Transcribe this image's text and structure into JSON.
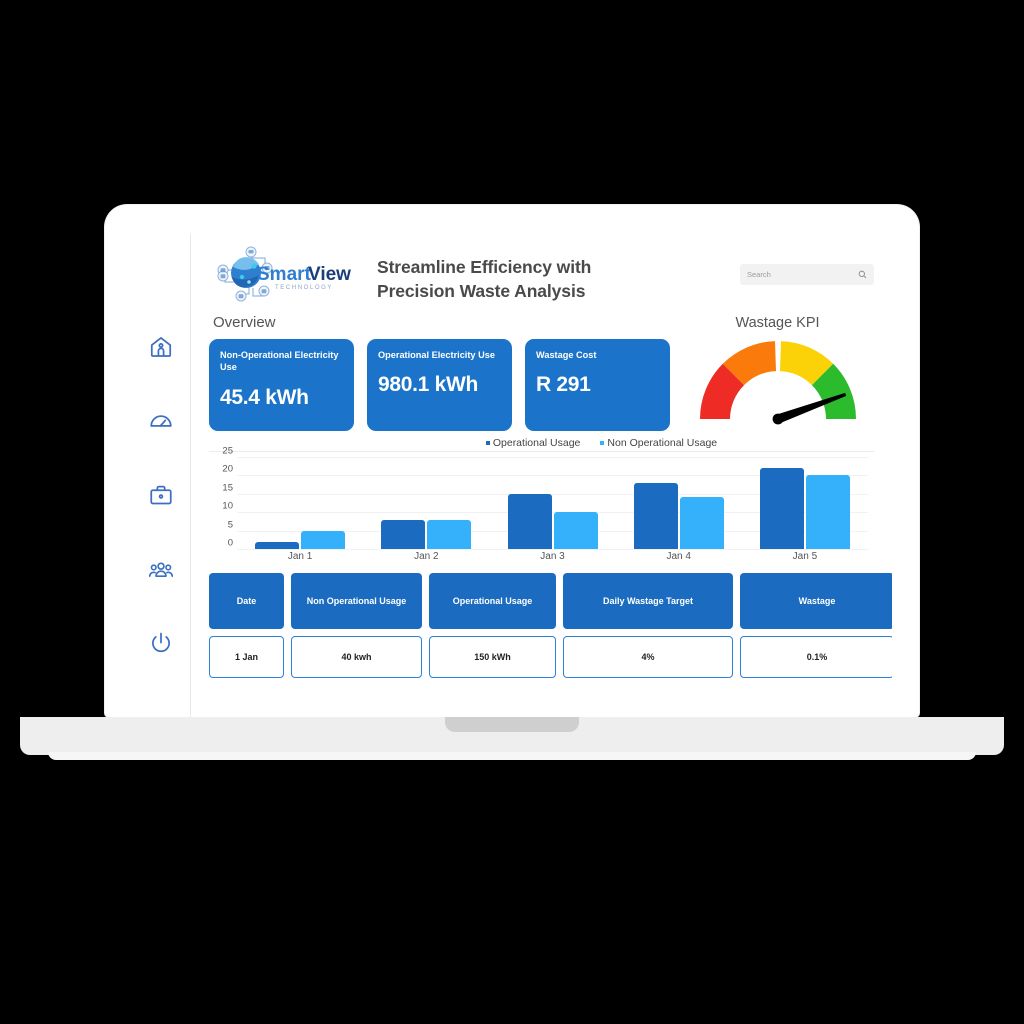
{
  "brand": {
    "name_light": "Smart",
    "name_bold": "View",
    "tagline": "TECHNOLOGY"
  },
  "header": {
    "title_line1": "Streamline Efficiency with",
    "title_line2": "Precision Waste Analysis",
    "search_placeholder": "Search",
    "search_value": "",
    "search_icon": "search-icon"
  },
  "sidebar": {
    "items": [
      {
        "name": "home",
        "icon": "home-icon"
      },
      {
        "name": "dashboard",
        "icon": "gauge-icon"
      },
      {
        "name": "briefcase",
        "icon": "briefcase-icon"
      },
      {
        "name": "users",
        "icon": "users-icon"
      },
      {
        "name": "power",
        "icon": "power-icon"
      }
    ]
  },
  "overview": {
    "label": "Overview",
    "cards": [
      {
        "label": "Non-Operational Electricity Use",
        "value": "45.4 kWh"
      },
      {
        "label": "Operational Electricity Use",
        "value": "980.1 kWh"
      },
      {
        "label": "Wastage Cost",
        "value": "R 291"
      }
    ]
  },
  "gauge": {
    "title": "Wastage KPI",
    "segments": [
      {
        "label": "critical",
        "color": "#ee2b24"
      },
      {
        "label": "poor",
        "color": "#fb7a0c"
      },
      {
        "label": "fair",
        "color": "#fbd107"
      },
      {
        "label": "good",
        "color": "#2cbb2c"
      }
    ],
    "needle_angle_deg": 20,
    "needle_color": "#000000"
  },
  "chart_data": {
    "type": "bar",
    "title": "",
    "xlabel": "",
    "ylabel": "",
    "categories": [
      "Jan 1",
      "Jan 2",
      "Jan 3",
      "Jan 4",
      "Jan 5"
    ],
    "yticks": [
      25,
      20,
      15,
      10,
      5,
      0
    ],
    "ylim": [
      0,
      25
    ],
    "grid": true,
    "legend_position": "top",
    "series": [
      {
        "name": "Operational Usage",
        "color": "#1b6cc0",
        "values": [
          2,
          8,
          15,
          18,
          22
        ]
      },
      {
        "name": "Non Operational Usage",
        "color": "#35b0fb",
        "values": [
          5,
          8,
          10,
          14,
          20
        ]
      }
    ]
  },
  "table": {
    "headers": [
      "Date",
      "Non Operational Usage",
      "Operational Usage",
      "Daily Wastage Target",
      "Wastage"
    ],
    "rows": [
      [
        "1 Jan",
        "40 kwh",
        "150 kWh",
        "4%",
        "0.1%"
      ]
    ]
  },
  "colors": {
    "brand_blue": "#1b74c9",
    "bar_dark": "#1b6cc0",
    "bar_light": "#35b0fb",
    "background": "#000000",
    "laptop_body": "#ffffff"
  }
}
